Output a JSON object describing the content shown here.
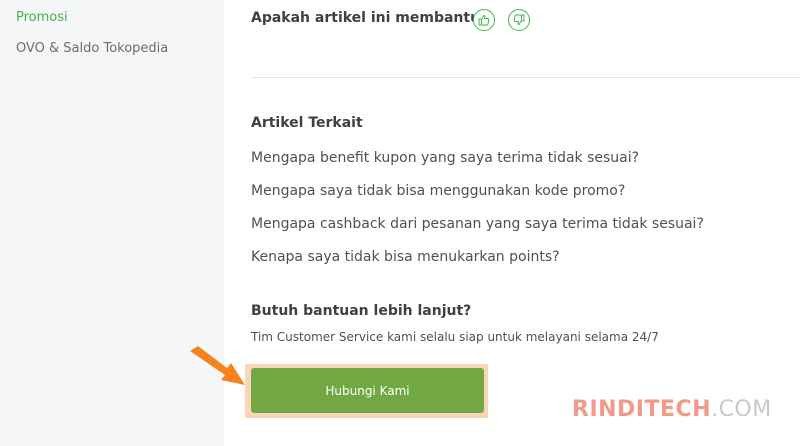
{
  "sidebar": {
    "items": [
      {
        "label": "Promosi",
        "active": true
      },
      {
        "label": "OVO & Saldo Tokopedia",
        "active": false
      }
    ]
  },
  "feedback": {
    "question": "Apakah artikel ini membantu?",
    "icons": [
      "thumbs-up-icon",
      "thumbs-down-icon"
    ]
  },
  "related": {
    "title": "Artikel Terkait",
    "items": [
      "Mengapa benefit kupon yang saya terima tidak sesuai?",
      "Mengapa saya tidak bisa menggunakan kode promo?",
      "Mengapa cashback dari pesanan yang saya terima tidak sesuai?",
      "Kenapa saya tidak bisa menukarkan points?"
    ]
  },
  "help": {
    "title": "Butuh bantuan lebih lanjut?",
    "subtitle": "Tim Customer Service kami selalu siap untuk melayani selama 24/7",
    "button_label": "Hubungi Kami"
  },
  "watermark": {
    "part1": "RINDITECH",
    "part2": ".COM"
  },
  "colors": {
    "brand_green": "#42b549",
    "button_green": "#72a844",
    "highlight_orange": "#f6821f"
  }
}
